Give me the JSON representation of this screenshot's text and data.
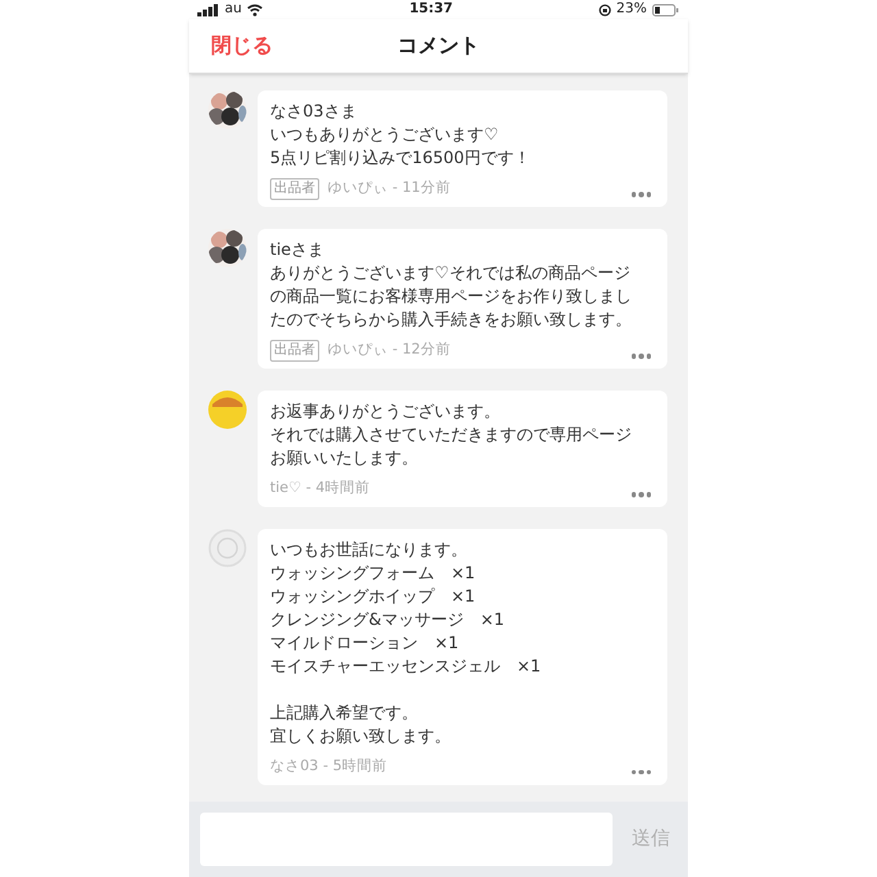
{
  "status_bar": {
    "carrier": "au",
    "time": "15:37",
    "battery": "23%"
  },
  "nav": {
    "close": "閉じる",
    "title": "コメント"
  },
  "comments": [
    {
      "paragraphs": [
        [
          "なさ03さま",
          "いつもありがとうございます♡",
          "5点リピ割り込みで16500円です！"
        ]
      ],
      "badge": "出品者",
      "meta": "ゆいぴぃ - 11分前"
    },
    {
      "paragraphs": [
        [
          "tieさま",
          "ありがとうございます♡それでは私の商品ページ",
          "の商品一覧にお客様専用ページをお作り致しまし",
          "たのでそちらから購入手続きをお願い致します。"
        ]
      ],
      "badge": "出品者",
      "meta": "ゆいぴぃ - 12分前"
    },
    {
      "kind": "character",
      "paragraphs": [
        [
          "お返事ありがとうございます。",
          "それでは購入させていただきますので専用ページ",
          "お願いいたします。"
        ]
      ],
      "meta": "tie♡ - 4時間前"
    },
    {
      "kind": "default",
      "paragraphs": [
        [
          "いつもお世話になります。",
          "ウォッシングフォーム　×1",
          "ウォッシングホイップ　×1",
          "クレンジング&マッサージ　×1",
          "マイルドローション　×1",
          "モイスチャーエッセンスジェル　×1"
        ],
        [
          "上記購入希望です。",
          "宜しくお願い致します。"
        ]
      ],
      "meta": "なさ03 - 5時間前"
    }
  ],
  "composer": {
    "send": "送信"
  }
}
